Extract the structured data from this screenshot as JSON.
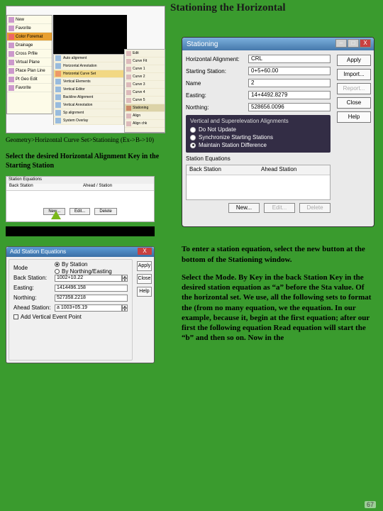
{
  "title": "Stationing the Horizontal",
  "left": {
    "caption1": "Geometry>Horizontal Curve Set>Stationing (Ex->B->10)",
    "caption2": "Select the desired Horizontal Alignment Key in the Starting Station",
    "menu": {
      "items": [
        "New",
        "Favorite",
        "Color Foremat",
        "Drainage",
        "Cross Prfile",
        "Virtual Plane",
        "Place Plan Line",
        "Pt Geo Edit",
        "Favorite"
      ],
      "highlighted_index": 2,
      "sub1": [
        "Auto alignment",
        "Horizontal Annotation",
        "Horizontal Curve Set",
        "Vertical Elements",
        "Vertical Editor",
        "Backline Alignment",
        "Vertical Annotation",
        "Sp alignment",
        "System Overlay"
      ],
      "sub1_highlight": 2,
      "sub2": [
        "Edit",
        "Curve Fit",
        "Curve 1",
        "Curve 2",
        "Curve 3",
        "Curve 4",
        "Curve 5",
        "Stationing",
        "Align",
        "Align chk"
      ],
      "sub2_highlight": 7
    },
    "mini": {
      "title": "Station Equations",
      "col1": "Back Station",
      "col2": "Ahead / Station",
      "btn_new": "New...",
      "btn_edit": "Edit...",
      "btn_del": "Delete"
    },
    "addStation": {
      "title": "Add Station Equations",
      "mode_label": "Mode",
      "mode_opt1": "By Station",
      "mode_opt2": "By Northing/Easting",
      "back_label": "Back Station:",
      "back_val": "1002+10.22",
      "easting_label": "Easting:",
      "easting_val": "1414496.158",
      "northing_label": "Northing:",
      "northing_val": "527358.2218",
      "ahead_label": "Ahead Station:",
      "ahead_val": "a 1003+05.19",
      "chk": "Add Vertical Event Point",
      "btn_apply": "Apply",
      "btn_close": "Close",
      "btn_help": "Help",
      "close_x": "X"
    }
  },
  "right": {
    "stationing": {
      "title": "Stationing",
      "align_label": "Horizontal Alignment:",
      "align_val": "CRL",
      "start_label": "Starting Station:",
      "start_val": "0+5+60.00",
      "name_label": "Name",
      "name_val": "2",
      "easting_label": "Easting:",
      "easting_val": "14+4492.8279",
      "northing_label": "Northing:",
      "northing_val": "528656.0096",
      "group_legend": "Vertical and Superelevation Alignments",
      "opt1": "Do Not Update",
      "opt2": "Synchronize Starting Stations",
      "opt3": "Maintain Station Difference",
      "eq_label": "Station Equations",
      "col_back": "Back Station",
      "col_ahead": "Ahead Station",
      "btn_new": "New...",
      "btn_edit": "Edit...",
      "btn_del": "Delete",
      "btn_apply": "Apply",
      "btn_import": "Import...",
      "btn_report": "Report...",
      "btn_close": "Close",
      "btn_help": "Help"
    },
    "para1": "To enter a station equation, select the new button at the bottom of the Stationing window.",
    "para2": "Select the Mode. By Key in the back Station Key in the desired station equation as “a” before the Sta value. Of the horizontal set. We use, all the following sets to format the (from no many equation, we the equation. In our example, because it, begin at the first equation; after our first the following equation Read equation will start the “b” and then so on. Now in the"
  },
  "page_number": "67"
}
